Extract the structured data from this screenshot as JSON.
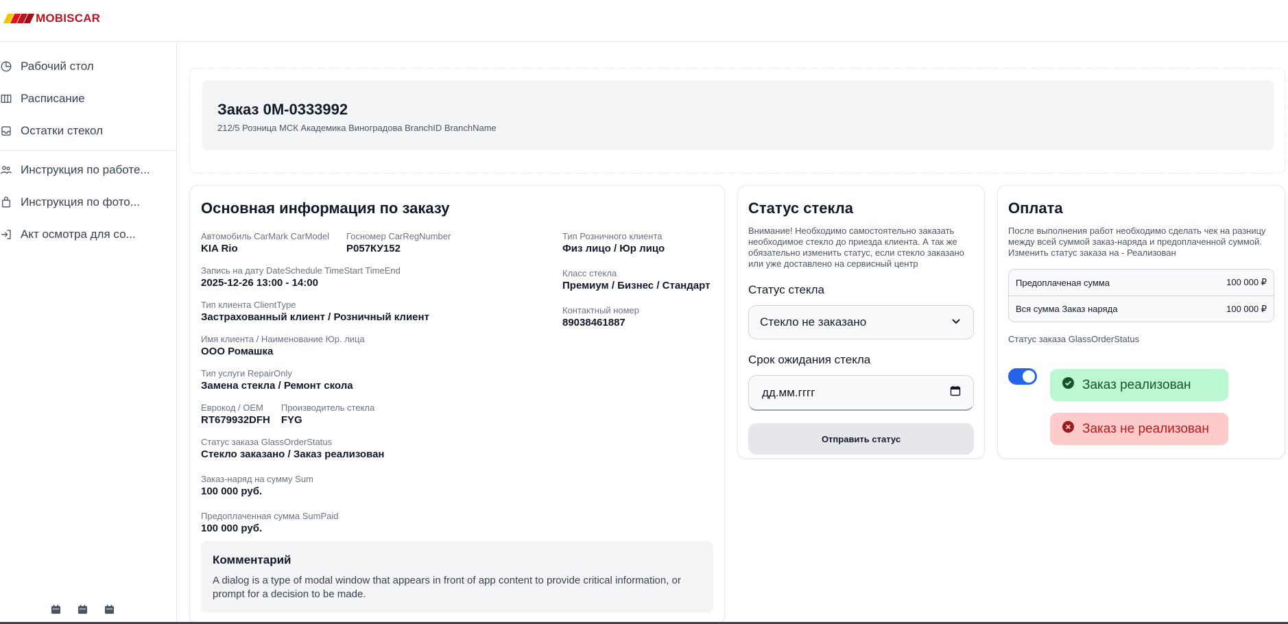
{
  "brand": {
    "name": "MOBISCAR",
    "colors": [
      "#f5c400",
      "#e3151a",
      "#c1121f",
      "#a00c17"
    ]
  },
  "sidebar": {
    "items": [
      {
        "label": "Рабочий стол",
        "icon": "pie-chart-icon"
      },
      {
        "label": "Расписание",
        "icon": "columns-icon"
      },
      {
        "label": "Остатки стекол",
        "icon": "inbox-icon"
      }
    ],
    "items2": [
      {
        "label": "Инструкция по работе...",
        "icon": "users-icon"
      },
      {
        "label": "Инструкция по фото...",
        "icon": "bag-icon"
      },
      {
        "label": "Акт осмотра для со...",
        "icon": "sign-in-icon"
      }
    ]
  },
  "order": {
    "title": "Заказ 0M-0333992",
    "subtitle": "212/5  Розница МСК Академика Виноградова BranchID BranchName"
  },
  "info": {
    "title": "Основная информация по заказу",
    "car": {
      "label": "Автомобиль CarMark CarModel",
      "value": "KIA Rio"
    },
    "plate": {
      "label": "Госномер CarRegNumber",
      "value": "Р057КУ152"
    },
    "schedule": {
      "label": "Запись на дату DateSchedule TimeStart TimeEnd",
      "value": "2025-12-26 13:00 - 14:00"
    },
    "client_type": {
      "label": "Тип клиента ClientType",
      "value": "Застрахованный клиент / Розничный клиент"
    },
    "client_name": {
      "label": "Имя клиента / Наименование Юр. лица",
      "value": "ООО Ромашка"
    },
    "service": {
      "label": "Тип услуги RepairOnly",
      "value": "Замена стекла / Ремонт скола"
    },
    "eurocode": {
      "label": "Еврокод / OEM",
      "value": "RT679932DFH"
    },
    "manufacturer": {
      "label": "Производитель стекла",
      "value": "FYG"
    },
    "glass_status": {
      "label": "Статус заказа GlassOrderStatus",
      "value": "Стекло заказано / Заказ реализован"
    },
    "sum": {
      "label": "Заказ-наряд на сумму Sum",
      "value": "100 000 руб."
    },
    "sum_paid": {
      "label": "Предоплаченная сумма SumPaid",
      "value": "100 000 руб."
    },
    "retail_type": {
      "label": "Тип Розничного клиента",
      "value": "Физ лицо / Юр лицо"
    },
    "glass_class": {
      "label": "Класс стекла",
      "value": "Премиум / Бизнес / Стандарт"
    },
    "phone": {
      "label": "Контактный номер",
      "value": "89038461887"
    },
    "comment": {
      "title": "Комментарий",
      "text": "A dialog is a type of modal window that appears in front of app content to provide critical information, or prompt for a decision to be made."
    }
  },
  "glass": {
    "title": "Статус стекла",
    "notice": "Внимание! Необходимо самостоятельно заказать необходимое стекло до приезда клиента. А так же обязательно изменить статус, если стекло заказано или уже доставлено на сервисный центр",
    "status_label": "Статус стекла",
    "status_value": "Стекло не заказано",
    "wait_label": "Срок ожидания стекла",
    "date_placeholder": "дд.мм.гггг",
    "send_button": "Отправить статус"
  },
  "payment": {
    "title": "Оплата",
    "notice": "После выполнения работ необходимо сделать чек на разницу между всей суммой заказ-наряда и предоплаченной суммой. Изменить статус заказа на - Реализован",
    "rows": [
      {
        "label": "Предоплаченая сумма",
        "value": "100 000 ₽"
      },
      {
        "label": "Вся сумма Заказ наряда",
        "value": "100 000 ₽"
      }
    ],
    "status_label": "Статус заказа GlassOrderStatus",
    "toggle_on": true,
    "done_label": "Заказ реализован",
    "not_done_label": "Заказ не реализован",
    "accent": "#2563eb"
  }
}
